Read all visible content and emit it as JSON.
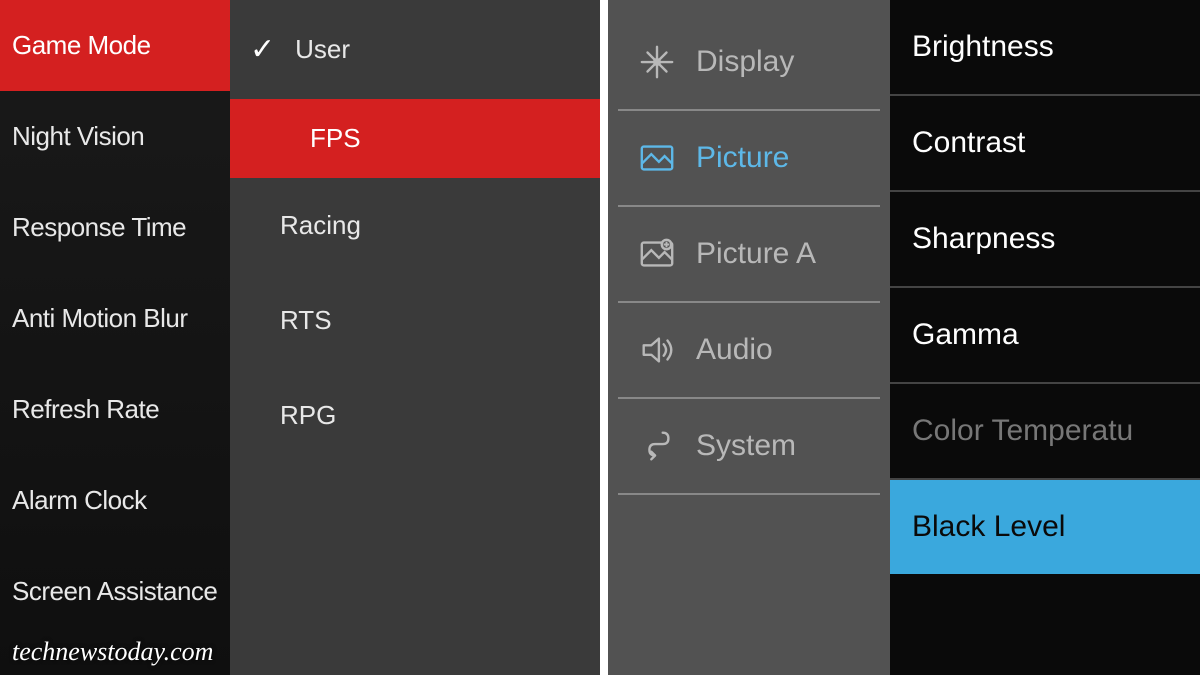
{
  "left_osd": {
    "sidebar": [
      {
        "label": "Game Mode",
        "selected": true
      },
      {
        "label": "Night Vision",
        "selected": false
      },
      {
        "label": "Response Time",
        "selected": false
      },
      {
        "label": "Anti Motion Blur",
        "selected": false
      },
      {
        "label": "Refresh Rate",
        "selected": false
      },
      {
        "label": "Alarm Clock",
        "selected": false
      },
      {
        "label": "Screen Assistance",
        "selected": false
      }
    ],
    "options": [
      {
        "label": "User",
        "checked": true,
        "highlight": false
      },
      {
        "label": "FPS",
        "checked": false,
        "highlight": true
      },
      {
        "label": "Racing",
        "checked": false,
        "highlight": false
      },
      {
        "label": "RTS",
        "checked": false,
        "highlight": false
      },
      {
        "label": "RPG",
        "checked": false,
        "highlight": false
      }
    ]
  },
  "right_osd": {
    "categories": [
      {
        "label": "Display",
        "icon": "display-icon",
        "active": false
      },
      {
        "label": "Picture",
        "icon": "picture-icon",
        "active": true
      },
      {
        "label": "Picture A",
        "icon": "picture-adv-icon",
        "active": false
      },
      {
        "label": "Audio",
        "icon": "audio-icon",
        "active": false
      },
      {
        "label": "System",
        "icon": "system-icon",
        "active": false
      }
    ],
    "submenu": [
      {
        "label": "Brightness",
        "state": "normal"
      },
      {
        "label": "Contrast",
        "state": "normal"
      },
      {
        "label": "Sharpness",
        "state": "normal"
      },
      {
        "label": "Gamma",
        "state": "normal"
      },
      {
        "label": "Color Temperatu",
        "state": "dim"
      },
      {
        "label": "Black Level",
        "state": "selected"
      }
    ]
  },
  "watermark": "technewstoday.com"
}
